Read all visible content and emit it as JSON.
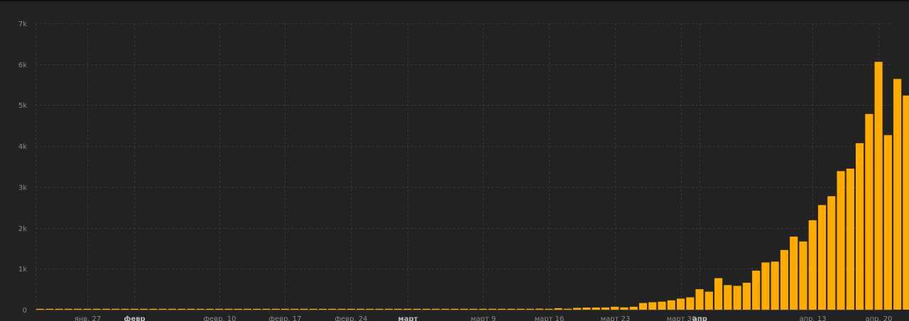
{
  "colors": {
    "background": "#222222",
    "bar": "#ffab00",
    "grid": "#3a3a3a",
    "label": "#8c8c8c"
  },
  "chart_data": {
    "type": "bar",
    "grid": true,
    "ylim": [
      0,
      7000
    ],
    "y_ticks": [
      {
        "value": 0,
        "label": "0"
      },
      {
        "value": 1000,
        "label": "1k"
      },
      {
        "value": 2000,
        "label": "2k"
      },
      {
        "value": 3000,
        "label": "3k"
      },
      {
        "value": 4000,
        "label": "4k"
      },
      {
        "value": 5000,
        "label": "5k"
      },
      {
        "value": 6000,
        "label": "6k"
      },
      {
        "value": 7000,
        "label": "7k"
      }
    ],
    "x_ticks": [
      {
        "date": "2020-01-27",
        "label": "янв. 27",
        "major": false
      },
      {
        "date": "2020-02-01",
        "label": "февр",
        "major": true
      },
      {
        "date": "2020-02-10",
        "label": "февр. 10",
        "major": false
      },
      {
        "date": "2020-02-17",
        "label": "февр. 17",
        "major": false
      },
      {
        "date": "2020-02-24",
        "label": "февр. 24",
        "major": false
      },
      {
        "date": "2020-03-01",
        "label": "март",
        "major": true
      },
      {
        "date": "2020-03-09",
        "label": "март 9",
        "major": false
      },
      {
        "date": "2020-03-16",
        "label": "март 16",
        "major": false
      },
      {
        "date": "2020-03-23",
        "label": "март 23",
        "major": false
      },
      {
        "date": "2020-03-30",
        "label": "март 30",
        "major": false
      },
      {
        "date": "2020-04-01",
        "label": "апр",
        "major": true
      },
      {
        "date": "2020-04-13",
        "label": "апр. 13",
        "major": false
      },
      {
        "date": "2020-04-20",
        "label": "апр. 20",
        "major": false
      }
    ],
    "categories": [
      "2020-01-22",
      "2020-01-23",
      "2020-01-24",
      "2020-01-25",
      "2020-01-26",
      "2020-01-27",
      "2020-01-28",
      "2020-01-29",
      "2020-01-30",
      "2020-01-31",
      "2020-02-01",
      "2020-02-02",
      "2020-02-03",
      "2020-02-04",
      "2020-02-05",
      "2020-02-06",
      "2020-02-07",
      "2020-02-08",
      "2020-02-09",
      "2020-02-10",
      "2020-02-11",
      "2020-02-12",
      "2020-02-13",
      "2020-02-14",
      "2020-02-15",
      "2020-02-16",
      "2020-02-17",
      "2020-02-18",
      "2020-02-19",
      "2020-02-20",
      "2020-02-21",
      "2020-02-22",
      "2020-02-23",
      "2020-02-24",
      "2020-02-25",
      "2020-02-26",
      "2020-02-27",
      "2020-02-28",
      "2020-02-29",
      "2020-03-01",
      "2020-03-02",
      "2020-03-03",
      "2020-03-04",
      "2020-03-05",
      "2020-03-06",
      "2020-03-07",
      "2020-03-08",
      "2020-03-09",
      "2020-03-10",
      "2020-03-11",
      "2020-03-12",
      "2020-03-13",
      "2020-03-14",
      "2020-03-15",
      "2020-03-16",
      "2020-03-17",
      "2020-03-18",
      "2020-03-19",
      "2020-03-20",
      "2020-03-21",
      "2020-03-22",
      "2020-03-23",
      "2020-03-24",
      "2020-03-25",
      "2020-03-26",
      "2020-03-27",
      "2020-03-28",
      "2020-03-29",
      "2020-03-30",
      "2020-03-31",
      "2020-04-01",
      "2020-04-02",
      "2020-04-03",
      "2020-04-04",
      "2020-04-05",
      "2020-04-06",
      "2020-04-07",
      "2020-04-08",
      "2020-04-09",
      "2020-04-10",
      "2020-04-11",
      "2020-04-12",
      "2020-04-13",
      "2020-04-14",
      "2020-04-15",
      "2020-04-16",
      "2020-04-17",
      "2020-04-18",
      "2020-04-19",
      "2020-04-20",
      "2020-04-21"
    ],
    "values": [
      0,
      0,
      0,
      0,
      0,
      0,
      0,
      0,
      0,
      1,
      0,
      1,
      0,
      0,
      0,
      0,
      0,
      0,
      0,
      0,
      0,
      0,
      0,
      0,
      0,
      0,
      0,
      0,
      0,
      0,
      0,
      0,
      0,
      0,
      0,
      0,
      0,
      0,
      0,
      0,
      1,
      0,
      2,
      0,
      3,
      0,
      0,
      0,
      3,
      7,
      6,
      5,
      11,
      24,
      20,
      36,
      22,
      44,
      52,
      53,
      54,
      71,
      57,
      71,
      163,
      182,
      196,
      228,
      270,
      302,
      500,
      440,
      771,
      601,
      582,
      658,
      954,
      1154,
      1175,
      1459,
      1786,
      1667,
      2186,
      2558,
      2774,
      3388,
      3448,
      4070,
      4785,
      6060,
      4268,
      5642,
      5236
    ]
  }
}
